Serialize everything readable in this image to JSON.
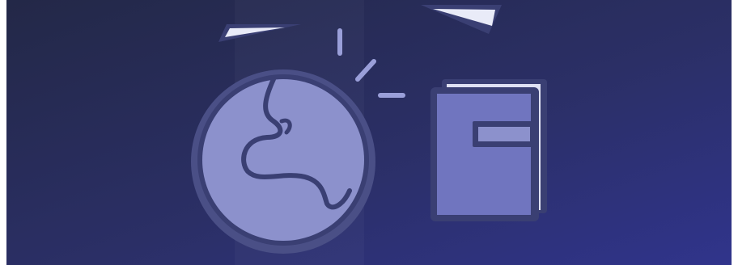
{
  "illustration": {
    "icons": [
      "globe-icon",
      "book-icon",
      "paper-plane-icon",
      "sparkle-lines-icon"
    ]
  },
  "colors": {
    "bg_dark": "#252a4d",
    "bg_mid": "#2b3068",
    "bg_light": "#30358a",
    "outline": "#3a3f73",
    "halo": "#4a4f86",
    "globe_fill": "#8c91cc",
    "book_fill": "#7075bf",
    "book_page": "#dfe1f3",
    "plane_fill": "#e9ebf8",
    "accent_lines": "#9a9fd9"
  }
}
